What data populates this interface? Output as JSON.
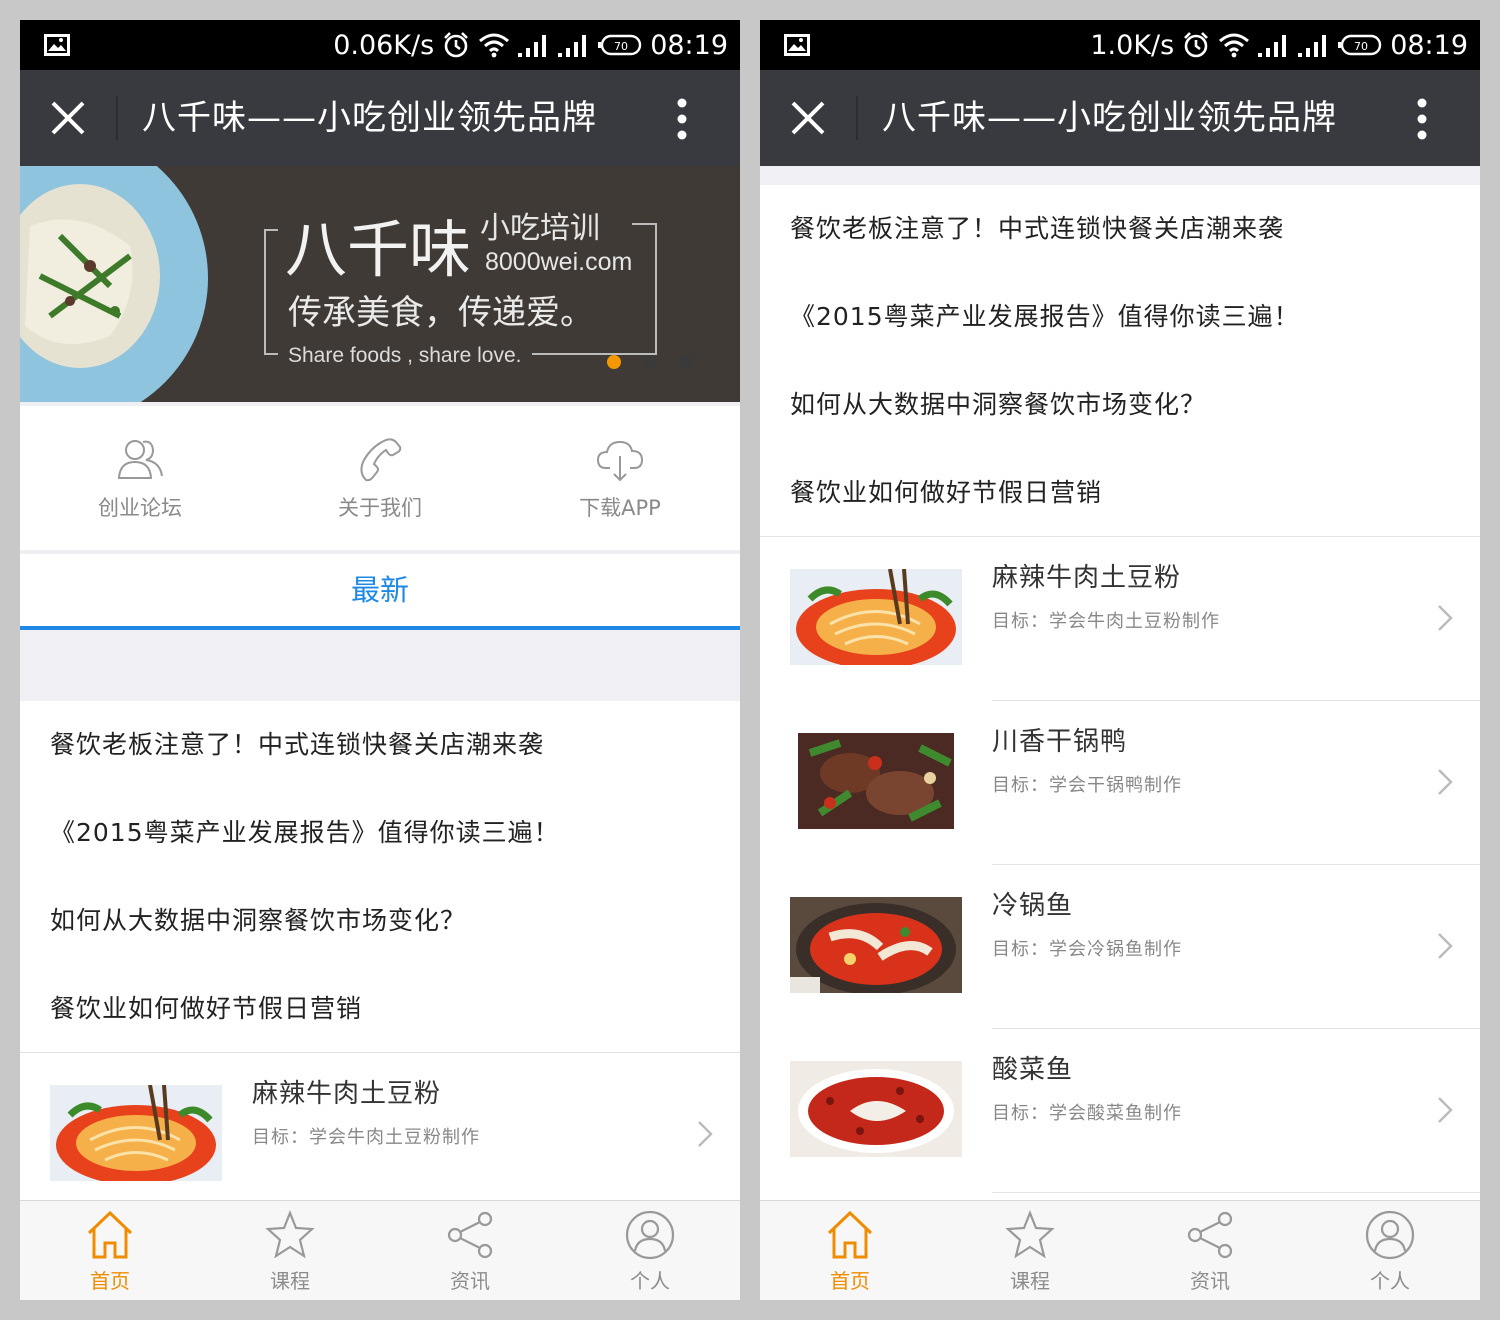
{
  "screens": [
    {
      "status": {
        "speed": "0.06K/s",
        "time": "08:19"
      },
      "nav": {
        "title": "八千味——小吃创业领先品牌"
      },
      "banner": {
        "brand": "八千味",
        "sub1": "小吃培训",
        "site": "8000wei.com",
        "slogan": "传承美食，传递爱。",
        "slogan_en": "Share foods , share love."
      },
      "quick_links": [
        {
          "label": "创业论坛",
          "icon": "users-icon"
        },
        {
          "label": "关于我们",
          "icon": "phone-icon"
        },
        {
          "label": "下载APP",
          "icon": "cloud-download-icon"
        }
      ],
      "tab_latest": "最新",
      "news": [
        "餐饮老板注意了！中式连锁快餐关店潮来袭",
        "《2015粤菜产业发展报告》值得你读三遍！",
        "如何从大数据中洞察餐饮市场变化？",
        "餐饮业如何做好节假日营销"
      ],
      "courses": [
        {
          "title": "麻辣牛肉土豆粉",
          "goal": "目标：学会牛肉土豆粉制作"
        }
      ]
    },
    {
      "status": {
        "speed": "1.0K/s",
        "time": "08:19"
      },
      "nav": {
        "title": "八千味——小吃创业领先品牌"
      },
      "news": [
        "餐饮老板注意了！中式连锁快餐关店潮来袭",
        "《2015粤菜产业发展报告》值得你读三遍！",
        "如何从大数据中洞察餐饮市场变化？",
        "餐饮业如何做好节假日营销"
      ],
      "courses": [
        {
          "title": "麻辣牛肉土豆粉",
          "goal": "目标：学会牛肉土豆粉制作"
        },
        {
          "title": "川香干锅鸭",
          "goal": "目标：学会干锅鸭制作"
        },
        {
          "title": "冷锅鱼",
          "goal": "目标：学会冷锅鱼制作"
        },
        {
          "title": "酸菜鱼",
          "goal": "目标：学会酸菜鱼制作"
        }
      ]
    }
  ],
  "tabbar": [
    {
      "label": "首页",
      "icon": "home-icon",
      "active": true
    },
    {
      "label": "课程",
      "icon": "star-icon",
      "active": false
    },
    {
      "label": "资讯",
      "icon": "share-icon",
      "active": false
    },
    {
      "label": "个人",
      "icon": "user-icon",
      "active": false
    }
  ],
  "colors": {
    "accent_blue": "#1e88e5",
    "active_orange": "#f08c00",
    "navbar": "#393a3f",
    "banner_dot_active": "#f39800"
  }
}
